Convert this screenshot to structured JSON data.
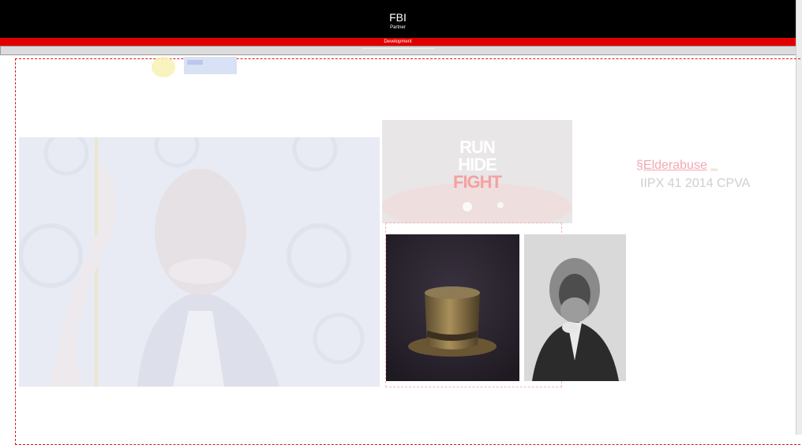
{
  "header": {
    "title": "FBI",
    "subtitle": "Partner"
  },
  "status_bar": {
    "label": "Development"
  },
  "notice_bar": {
    "text": "˜˜˜˜˜˜˜˜˜˜˜˜˜˜˜˜˜˜˜˜˜˜˜˜˜˜˜˜˜˜˜˜˜˜˜˜˜˜˜˜˜˜˜˜˜˜˜˜˜˜˜˜˜˜˜"
  },
  "promo_image": {
    "line1": "RUN",
    "line2": "HIDE",
    "line3": "FIGHT"
  },
  "side_links": {
    "prefix": "§",
    "link": "Elderabuse",
    "suffix": "....",
    "line2": "IIPX 41 2014 CPVA"
  },
  "colors": {
    "header_bg": "#000000",
    "accent_red": "#e00000",
    "dashed_red": "#d81818",
    "link_pink": "#f3a8b4",
    "fight_red": "#f26d6d"
  },
  "icons": {
    "portrait": "portrait-photo-icon",
    "hat": "top-hat-photo-icon",
    "douglass": "portrait-photo-icon"
  }
}
